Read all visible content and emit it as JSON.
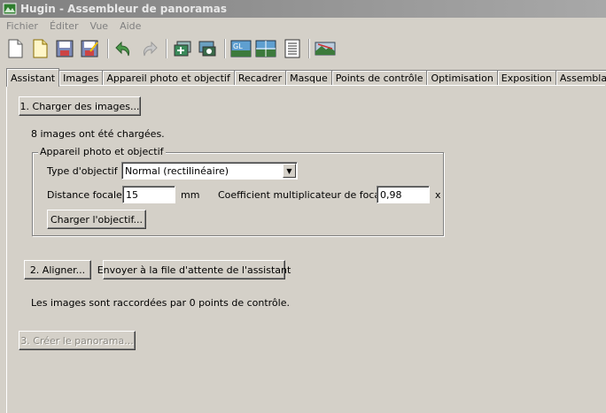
{
  "window": {
    "title": "Hugin - Assembleur de panoramas"
  },
  "menu": [
    "Fichier",
    "Éditer",
    "Vue",
    "Aide"
  ],
  "toolbar_icons": [
    "new-file-icon",
    "open-file-icon",
    "save-icon",
    "save-as-icon",
    "undo-icon",
    "redo-icon",
    "add-images-icon",
    "add-images-time-icon",
    "opengl-preview-icon",
    "fast-preview-icon",
    "image-list-icon",
    "preview-panorama-icon"
  ],
  "tabs": [
    "Assistant",
    "Images",
    "Appareil photo et objectif",
    "Recadrer",
    "Masque",
    "Points de contrôle",
    "Optimisation",
    "Exposition",
    "Assemblage"
  ],
  "assistant": {
    "load_button": "1. Charger des images...",
    "images_loaded": "8 images ont été chargées.",
    "group_title": "Appareil photo et objectif",
    "lens_type_label": "Type d'objectif :",
    "lens_type_value": "Normal (rectilinéaire)",
    "focal_label": "Distance focale :",
    "focal_value": "15",
    "focal_unit": "mm",
    "crop_label": "Coefficient multiplicateur de focale :",
    "crop_value": "0,98",
    "crop_unit": "x",
    "load_lens_button": "Charger l'objectif...",
    "align_button": "2. Aligner...",
    "queue_button": "Envoyer à la file d'attente de l'assistant",
    "status": "Les images sont raccordées par 0 points de contrôle.",
    "create_button": "3. Créer le panorama..."
  }
}
